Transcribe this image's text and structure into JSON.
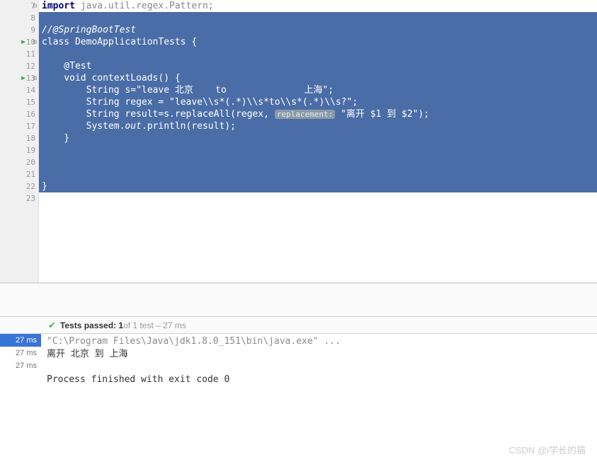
{
  "lines": [
    {
      "num": "7",
      "fold": "-",
      "sel": false,
      "content_parts": [
        "import_kw",
        "import_text"
      ]
    },
    {
      "num": "8",
      "sel": true,
      "blank": true
    },
    {
      "num": "9",
      "sel": true,
      "comment": "//@SpringBootTest"
    },
    {
      "num": "10",
      "run": true,
      "fold": "-",
      "sel": true,
      "class_decl": true
    },
    {
      "num": "11",
      "sel": true,
      "blank": true
    },
    {
      "num": "12",
      "sel": true,
      "annotation": "    @Test"
    },
    {
      "num": "13",
      "run": true,
      "fold": "-",
      "sel": true,
      "method_decl": true
    },
    {
      "num": "14",
      "sel": true,
      "string_line": true
    },
    {
      "num": "15",
      "sel": true,
      "regex_line": true
    },
    {
      "num": "16",
      "sel": true,
      "result_line": true
    },
    {
      "num": "17",
      "sel": true,
      "println_line": true
    },
    {
      "num": "18",
      "sel": true,
      "text": "    }"
    },
    {
      "num": "19",
      "sel": true,
      "blank": true
    },
    {
      "num": "20",
      "sel": true,
      "blank": true
    },
    {
      "num": "21",
      "sel": true,
      "blank": true
    },
    {
      "num": "22",
      "sel": true,
      "text": "}"
    },
    {
      "num": "23",
      "sel": false,
      "blank": true
    }
  ],
  "code": {
    "import_kw": "import",
    "import_rest": " java.util.regex.Pattern;",
    "class_kw": "class",
    "class_name": " DemoApplicationTests {",
    "void_kw": "void",
    "method_name": " contextLoads() {",
    "string_type": "String",
    "s_var": " s=",
    "s_val": "\"leave 北京    to              上海\"",
    "regex_var": " regex = ",
    "regex_val": "\"leave\\\\s*(.*)\\\\s*to\\\\s*(.*)\\\\s?\"",
    "result_var": " result=s.replaceAll(regex,",
    "hint": "replacement:",
    "repl_val": "\"离开 $1 到 $2\"",
    "println_pre": "        System.",
    "out": "out",
    "println_post": ".println(result);"
  },
  "test_header": {
    "label": "Tests passed:",
    "count": "1",
    "suffix": " of 1 test – 27 ms"
  },
  "times": [
    "27 ms",
    "27 ms",
    "27 ms"
  ],
  "console": {
    "cmd": "\"C:\\Program Files\\Java\\jdk1.8.0_151\\bin\\java.exe\" ...",
    "out1": "离开 北京     到 上海",
    "out2": "Process finished with exit code 0"
  },
  "watermark": "CSDN @i学长的猫"
}
